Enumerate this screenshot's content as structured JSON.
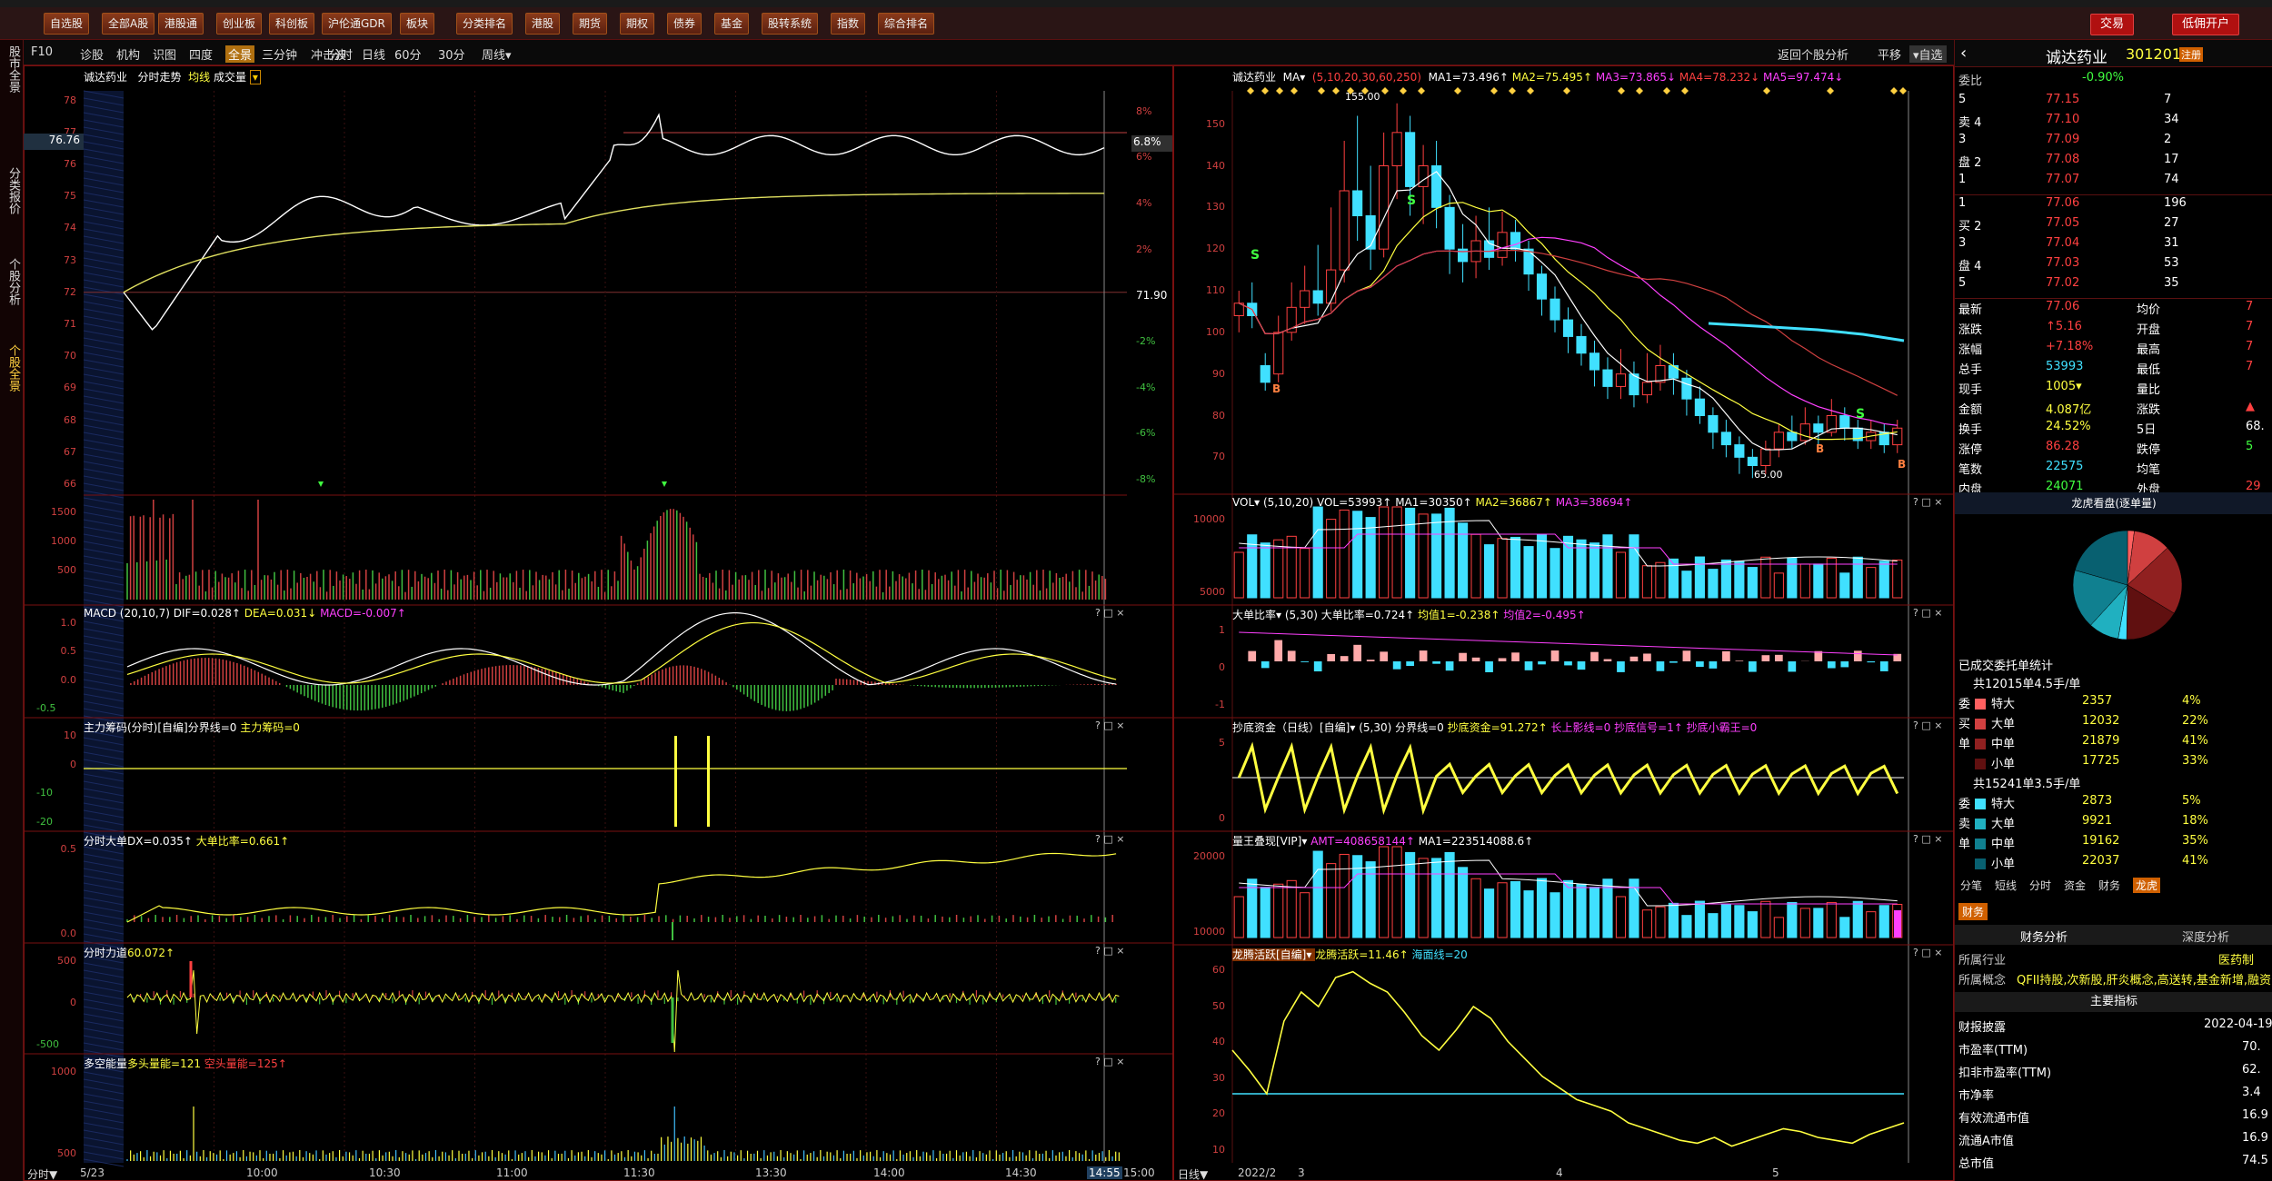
{
  "menu": [
    "自选股",
    "全部A股",
    "港股通",
    "创业板",
    "科创板",
    "沪伦通GDR",
    "板块",
    "分类排名",
    "港股",
    "期货",
    "期权",
    "债券",
    "基金",
    "股转系统",
    "指数",
    "综合排名"
  ],
  "right_buttons": [
    "交易",
    "低佣开户"
  ],
  "side_tabs": [
    "股市全景",
    "分类报价",
    "个股分析",
    "个股全景"
  ],
  "toolbar": {
    "left": [
      "F10",
      "诊股",
      "机构",
      "识图",
      "四度",
      "全景",
      "三分钟",
      "冲击波"
    ],
    "periods": [
      "分时",
      "日线",
      "60分",
      "30分",
      "周线▾"
    ],
    "right": [
      "返回个股分析",
      "平移",
      "▾自选"
    ]
  },
  "intraday": {
    "title": "诚达药业",
    "subtitle": "分时走势",
    "tag1": "均线",
    "tag2": "成交量",
    "price_ticks": [
      "78",
      "77",
      "76",
      "75",
      "74",
      "73",
      "72",
      "71",
      "70",
      "69",
      "68",
      "67",
      "66"
    ],
    "pct_ticks": [
      "8%",
      "6%",
      "4%",
      "2%",
      "-2%",
      "-4%",
      "-6%",
      "-8%"
    ],
    "current_price": "76.76",
    "current_pct": "6.8%",
    "prev_close_label": "71.90",
    "vol_ticks": [
      "1500",
      "1000",
      "500"
    ],
    "time_ticks": [
      "5/23",
      "10:00",
      "10:30",
      "11:00",
      "11:30",
      "13:30",
      "14:00",
      "14:30",
      "14:55",
      "15:00"
    ],
    "time_label": "分时"
  },
  "ind_panels": [
    {
      "name": "MACD",
      "params": "(20,10,7)",
      "vals": [
        {
          "t": "DIF=0.028↑",
          "c": "white"
        },
        {
          "t": "DEA=0.031↓",
          "c": "yellow"
        },
        {
          "t": "MACD=-0.007↑",
          "c": "magenta"
        }
      ],
      "ticks": [
        "1.0",
        "0.5",
        "0.0",
        "-0.5"
      ]
    },
    {
      "name": "主力筹码(分时)[自编]",
      "params": "",
      "vals": [
        {
          "t": "分界线=0",
          "c": "white"
        },
        {
          "t": "主力筹码=0",
          "c": "yellow"
        }
      ],
      "ticks": [
        "10",
        "0",
        "-10",
        "-20"
      ]
    },
    {
      "name": "分时大单",
      "params": "",
      "vals": [
        {
          "t": "DX=0.035↑",
          "c": "white"
        },
        {
          "t": "大单比率=0.661↑",
          "c": "yellow"
        }
      ],
      "ticks": [
        "0.5",
        "0.0"
      ]
    },
    {
      "name": "分时力道",
      "params": "",
      "vals": [
        {
          "t": "60.072↑",
          "c": "yellow"
        }
      ],
      "ticks": [
        "500",
        "0",
        "-500"
      ]
    },
    {
      "name": "多空能量",
      "params": "",
      "vals": [
        {
          "t": "多头量能=121",
          "c": "yellow"
        },
        {
          "t": "空头量能=125↑",
          "c": "red"
        }
      ],
      "ticks": [
        "1000",
        "500"
      ]
    }
  ],
  "kline": {
    "title": "诚达药业",
    "ma_label": "MA▾",
    "ma_params": "(5,10,20,30,60,250)",
    "mas": [
      {
        "t": "MA1=73.496↑",
        "c": "white"
      },
      {
        "t": "MA2=75.495↑",
        "c": "yellow"
      },
      {
        "t": "MA3=73.865↓",
        "c": "magenta"
      },
      {
        "t": "MA4=78.232↓",
        "c": "red"
      },
      {
        "t": "MA5=97.474↓",
        "c": "magenta"
      }
    ],
    "price_ticks": [
      "150",
      "140",
      "130",
      "120",
      "110",
      "100",
      "90",
      "80",
      "70"
    ],
    "high_label": "155.00",
    "low_label": "65.00",
    "date_ticks": [
      "2022/2",
      "3",
      "4",
      "5"
    ],
    "date_label": "日线",
    "candles": [
      {
        "o": 104,
        "c": 107,
        "h": 110,
        "l": 100
      },
      {
        "o": 107,
        "c": 104,
        "h": 112,
        "l": 101
      },
      {
        "o": 92,
        "c": 88,
        "h": 95,
        "l": 86
      },
      {
        "o": 90,
        "c": 100,
        "h": 104,
        "l": 88
      },
      {
        "o": 100,
        "c": 106,
        "h": 112,
        "l": 98
      },
      {
        "o": 106,
        "c": 110,
        "h": 116,
        "l": 102
      },
      {
        "o": 110,
        "c": 107,
        "h": 121,
        "l": 104
      },
      {
        "o": 107,
        "c": 115,
        "h": 130,
        "l": 105
      },
      {
        "o": 115,
        "c": 134,
        "h": 146,
        "l": 112
      },
      {
        "o": 134,
        "c": 128,
        "h": 152,
        "l": 122
      },
      {
        "o": 128,
        "c": 120,
        "h": 140,
        "l": 115
      },
      {
        "o": 120,
        "c": 140,
        "h": 148,
        "l": 118
      },
      {
        "o": 140,
        "c": 148,
        "h": 155,
        "l": 132
      },
      {
        "o": 148,
        "c": 135,
        "h": 152,
        "l": 128
      },
      {
        "o": 135,
        "c": 140,
        "h": 145,
        "l": 126
      },
      {
        "o": 140,
        "c": 130,
        "h": 146,
        "l": 125
      },
      {
        "o": 130,
        "c": 120,
        "h": 133,
        "l": 114
      },
      {
        "o": 120,
        "c": 117,
        "h": 126,
        "l": 112
      },
      {
        "o": 117,
        "c": 122,
        "h": 128,
        "l": 113
      },
      {
        "o": 122,
        "c": 118,
        "h": 130,
        "l": 115
      },
      {
        "o": 118,
        "c": 124,
        "h": 129,
        "l": 116
      },
      {
        "o": 124,
        "c": 120,
        "h": 127,
        "l": 117
      },
      {
        "o": 120,
        "c": 114,
        "h": 122,
        "l": 110
      },
      {
        "o": 114,
        "c": 108,
        "h": 116,
        "l": 104
      },
      {
        "o": 108,
        "c": 103,
        "h": 111,
        "l": 100
      },
      {
        "o": 103,
        "c": 99,
        "h": 106,
        "l": 95
      },
      {
        "o": 99,
        "c": 95,
        "h": 102,
        "l": 92
      },
      {
        "o": 95,
        "c": 91,
        "h": 98,
        "l": 87
      },
      {
        "o": 91,
        "c": 87,
        "h": 94,
        "l": 84
      },
      {
        "o": 87,
        "c": 90,
        "h": 96,
        "l": 84
      },
      {
        "o": 90,
        "c": 85,
        "h": 93,
        "l": 82
      },
      {
        "o": 85,
        "c": 88,
        "h": 95,
        "l": 83
      },
      {
        "o": 88,
        "c": 92,
        "h": 97,
        "l": 86
      },
      {
        "o": 92,
        "c": 89,
        "h": 95,
        "l": 85
      },
      {
        "o": 89,
        "c": 84,
        "h": 91,
        "l": 80
      },
      {
        "o": 84,
        "c": 80,
        "h": 87,
        "l": 78
      },
      {
        "o": 80,
        "c": 76,
        "h": 82,
        "l": 72
      },
      {
        "o": 76,
        "c": 73,
        "h": 79,
        "l": 70
      },
      {
        "o": 73,
        "c": 70,
        "h": 75,
        "l": 66
      },
      {
        "o": 70,
        "c": 68,
        "h": 72,
        "l": 65
      },
      {
        "o": 68,
        "c": 72,
        "h": 74,
        "l": 66
      },
      {
        "o": 72,
        "c": 76,
        "h": 78,
        "l": 70
      },
      {
        "o": 76,
        "c": 74,
        "h": 80,
        "l": 72
      },
      {
        "o": 74,
        "c": 78,
        "h": 82,
        "l": 73
      },
      {
        "o": 78,
        "c": 76,
        "h": 80,
        "l": 73
      },
      {
        "o": 76,
        "c": 80,
        "h": 84,
        "l": 75
      },
      {
        "o": 80,
        "c": 77,
        "h": 82,
        "l": 74
      },
      {
        "o": 77,
        "c": 74,
        "h": 79,
        "l": 72
      },
      {
        "o": 74,
        "c": 76,
        "h": 79,
        "l": 72
      },
      {
        "o": 76,
        "c": 73,
        "h": 78,
        "l": 71
      },
      {
        "o": 73,
        "c": 77,
        "h": 79,
        "l": 71
      }
    ]
  },
  "k_panels": [
    {
      "name": "VOL▾",
      "params": "(5,10,20)",
      "vals": [
        {
          "t": "VOL=53993↑",
          "c": "white"
        },
        {
          "t": "MA1=30350↑",
          "c": "white"
        },
        {
          "t": "MA2=36867↑",
          "c": "yellow"
        },
        {
          "t": "MA3=38694↑",
          "c": "magenta"
        }
      ],
      "ticks": [
        "10000",
        "5000"
      ]
    },
    {
      "name": "大单比率▾",
      "params": "(5,30)",
      "vals": [
        {
          "t": "大单比率=0.724↑",
          "c": "white"
        },
        {
          "t": "均值1=-0.238↑",
          "c": "yellow"
        },
        {
          "t": "均值2=-0.495↑",
          "c": "magenta"
        }
      ],
      "ticks": [
        "1",
        "0",
        "-1"
      ]
    },
    {
      "name": "抄底资金（日线）[自编]▾",
      "params": "(5,30)",
      "vals": [
        {
          "t": "分界线=0",
          "c": "white"
        },
        {
          "t": "抄底资金=91.272↑",
          "c": "yellow"
        },
        {
          "t": "长上影线=0",
          "c": "magenta"
        },
        {
          "t": "抄底信号=1↑",
          "c": "magenta"
        },
        {
          "t": "抄底小霸王=0",
          "c": "magenta"
        }
      ],
      "ticks": [
        "5",
        "0"
      ]
    },
    {
      "name": "量王叠现[VIP]▾",
      "params": "",
      "vals": [
        {
          "t": "AMT=408658144↑",
          "c": "magenta"
        },
        {
          "t": "MA1=223514088.6↑",
          "c": "white"
        }
      ],
      "ticks": [
        "20000",
        "10000"
      ]
    },
    {
      "name": "龙腾活跃[自编]▾",
      "params": "",
      "vals": [
        {
          "t": "龙腾活跃=11.46↑",
          "c": "yellow"
        },
        {
          "t": "海面线=20",
          "c": "cyan"
        }
      ],
      "ticks": [
        "60",
        "50",
        "40",
        "30",
        "20",
        "10"
      ]
    }
  ],
  "quote": {
    "name": "诚达药业",
    "code": "301201",
    "badge": "注册",
    "webi_label": "委比",
    "webi": "-0.90%",
    "sell": [
      {
        "l": "5",
        "p": "77.15",
        "v": "7"
      },
      {
        "l": "卖 4",
        "p": "77.10",
        "v": "34"
      },
      {
        "l": "3",
        "p": "77.09",
        "v": "2"
      },
      {
        "l": "盘 2",
        "p": "77.08",
        "v": "17"
      },
      {
        "l": "1",
        "p": "77.07",
        "v": "74"
      }
    ],
    "buy": [
      {
        "l": "1",
        "p": "77.06",
        "v": "196"
      },
      {
        "l": "买 2",
        "p": "77.05",
        "v": "27"
      },
      {
        "l": "3",
        "p": "77.04",
        "v": "31"
      },
      {
        "l": "盘 4",
        "p": "77.03",
        "v": "53"
      },
      {
        "l": "5",
        "p": "77.02",
        "v": "35"
      }
    ],
    "stats": [
      {
        "a": "最新",
        "av": "77.06",
        "ac": "red",
        "b": "均价",
        "bv": "7",
        "bc": "red"
      },
      {
        "a": "涨跌",
        "av": "↑5.16",
        "ac": "red",
        "b": "开盘",
        "bv": "7",
        "bc": "red"
      },
      {
        "a": "涨幅",
        "av": "+7.18%",
        "ac": "red",
        "b": "最高",
        "bv": "7",
        "bc": "red"
      },
      {
        "a": "总手",
        "av": "53993",
        "ac": "cyan",
        "b": "最低",
        "bv": "7",
        "bc": "red"
      },
      {
        "a": "现手",
        "av": "1005▾",
        "ac": "yellow",
        "b": "量比",
        "bv": "",
        "bc": "red"
      },
      {
        "a": "金额",
        "av": "4.087亿",
        "ac": "yellow",
        "b": "涨跌",
        "bv": "▲",
        "bc": "red"
      },
      {
        "a": "换手",
        "av": "24.52%",
        "ac": "yellow",
        "b": "5日",
        "bv": "68.",
        "bc": "white"
      },
      {
        "a": "涨停",
        "av": "86.28",
        "ac": "red",
        "b": "跌停",
        "bv": "5",
        "bc": "green"
      },
      {
        "a": "笔数",
        "av": "22575",
        "ac": "cyan",
        "b": "均笔",
        "bv": "",
        "bc": "white"
      },
      {
        "a": "内盘",
        "av": "24071",
        "ac": "green",
        "b": "外盘",
        "bv": "29",
        "bc": "red"
      }
    ],
    "lhb_title": "龙虎看盘(逐单量)",
    "lhb_sub": "已成交委托单统计",
    "buy_summary": "共12015单4.5手/单",
    "sell_summary": "共15241单3.5手/单",
    "buy_rows": [
      {
        "t": "特大",
        "v": "2357",
        "p": "4%",
        "c": "#ff6060"
      },
      {
        "t": "大单",
        "v": "12032",
        "p": "22%",
        "c": "#d04040"
      },
      {
        "t": "中单",
        "v": "21879",
        "p": "41%",
        "c": "#902020"
      },
      {
        "t": "小单",
        "v": "17725",
        "p": "33%",
        "c": "#601010"
      }
    ],
    "buy_side": [
      "委",
      "买",
      "单"
    ],
    "sell_rows": [
      {
        "t": "特大",
        "v": "2873",
        "p": "5%",
        "c": "#40e0ff"
      },
      {
        "t": "大单",
        "v": "9921",
        "p": "18%",
        "c": "#20b0c0"
      },
      {
        "t": "中单",
        "v": "19162",
        "p": "35%",
        "c": "#108090"
      },
      {
        "t": "小单",
        "v": "22037",
        "p": "41%",
        "c": "#086070"
      }
    ],
    "sell_side": [
      "委",
      "卖",
      "单"
    ],
    "tabs": [
      "分笔",
      "短线",
      "分时",
      "资金",
      "财务",
      "龙虎"
    ],
    "fin_tab": "财务",
    "fin_sub": [
      "财务分析",
      "深度分析"
    ],
    "industry_label": "所属行业",
    "industry": "医药制",
    "concept_label": "所属概念",
    "concept": "QFII持股,次新股,肝炎概念,高送转,基金新增,融资",
    "main_idx": "主要指标",
    "fin_rows": [
      {
        "a": "财报披露",
        "v": "2022-04-19"
      },
      {
        "a": "市盈率(TTM)",
        "v": "70."
      },
      {
        "a": "扣非市盈率(TTM)",
        "v": "62."
      },
      {
        "a": "市净率",
        "v": "3.4"
      },
      {
        "a": "有效流通市值",
        "v": "16.9"
      },
      {
        "a": "流通A市值",
        "v": "16.9"
      },
      {
        "a": "总市值",
        "v": "74.5"
      }
    ]
  }
}
